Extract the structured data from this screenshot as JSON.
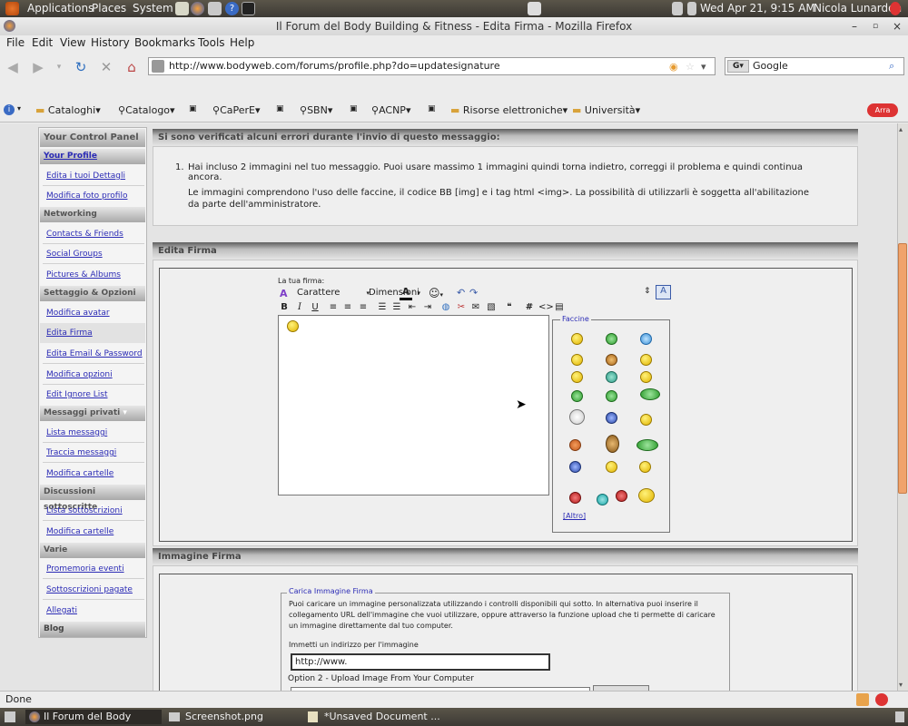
{
  "panel": {
    "menus": [
      "Applications",
      "Places",
      "System"
    ],
    "clock": "Wed Apr 21,  9:15 AM",
    "user": "Nicola Lunardon"
  },
  "window": {
    "title": "Il Forum del Body Building & Fitness - Edita Firma - Mozilla Firefox"
  },
  "menubar": [
    "File",
    "Edit",
    "View",
    "History",
    "Bookmarks",
    "Tools",
    "Help"
  ],
  "nav": {
    "url": "http://www.bodyweb.com/forums/profile.php?do=updatesignature",
    "search_engine_text": "Google"
  },
  "bookmarks": [
    "Cataloghi",
    "Catalogo",
    "CaPerE",
    "SBN",
    "ACNP",
    "Risorse elettroniche",
    "Università"
  ],
  "sidebar": {
    "title": "Your Control Panel",
    "sections": [
      {
        "header": "Your Profile",
        "links": [
          "Edita i tuoi Dettagli",
          "Modifica foto profilo"
        ]
      },
      {
        "header": "Networking",
        "links": [
          "Contacts & Friends",
          "Social Groups",
          "Pictures & Albums"
        ]
      },
      {
        "header": "Settaggio & Opzioni",
        "links": [
          "Modifica avatar",
          "Edita Firma",
          "Edita Email & Password",
          "Modifica opzioni",
          "Edit Ignore List"
        ]
      },
      {
        "header": "Messaggi privati",
        "links": [
          "Lista messaggi",
          "Traccia messaggi",
          "Modifica cartelle"
        ]
      },
      {
        "header": "Discussioni sottoscritte",
        "links": [
          "Lista sottoscrizioni",
          "Modifica cartelle"
        ]
      },
      {
        "header": "Varie",
        "links": [
          "Promemoria eventi",
          "Sottoscrizioni pagate",
          "Allegati"
        ]
      },
      {
        "header": "Blog",
        "links": []
      }
    ]
  },
  "errors": {
    "title": "Si sono verificati alcuni errori durante l'invio di questo messaggio:",
    "item_number": "1.",
    "line1": "Hai incluso 2 immagini nel tuo messaggio. Puoi usare massimo 1 immagini quindi torna indietro, correggi il problema e quindi continua ancora.",
    "line2": "Le immagini comprendono l'uso delle faccine, il codice BB [img] e i tag html <img>. La possibilità di utilizzarli è soggetta all'abilitazione da parte dell'amministratore."
  },
  "signature": {
    "title": "Edita Firma",
    "label": "La tua firma:",
    "font_select": "Carattere",
    "size_select": "Dimensioni",
    "smilies_title": "Faccine",
    "smilies_more": "[Altro]"
  },
  "image": {
    "title": "Immagine Firma",
    "fieldset_title": "Carica Immagine Firma",
    "desc": "Puoi caricare un immagine personalizzata utilizzando i controlli disponibili qui sotto. In alternativa puoi inserire il collegamento URL dell'immagine che vuoi utilizzare, oppure attraverso la funzione upload che ti permette di caricare un immagine direttamente dal tuo computer.",
    "url_label": "Immetti un indirizzo per l'immagine",
    "url_value": "http://www.",
    "option2": "Option 2 - Upload Image From Your Computer"
  },
  "status": "Done",
  "taskbar": [
    "Il Forum del Body Buil...",
    "Screenshot.png",
    "*Unsaved Document ..."
  ]
}
